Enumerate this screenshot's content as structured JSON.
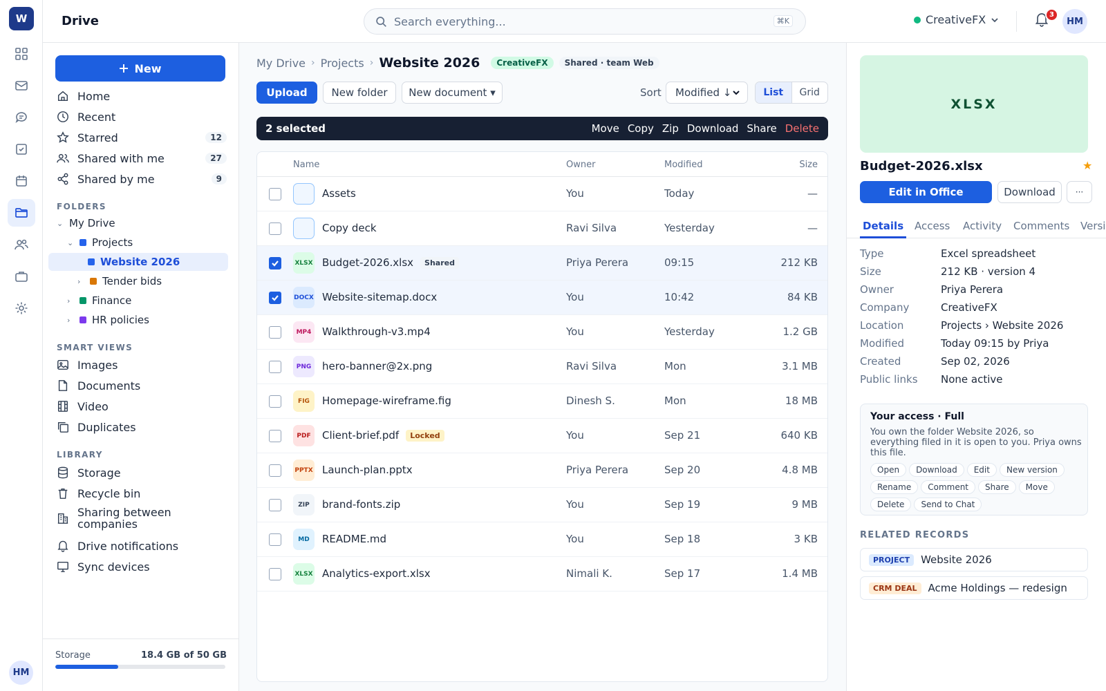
{
  "rail": {
    "logo": "W",
    "icons": [
      "apps-icon",
      "mail-icon",
      "chat-icon",
      "tasks-icon",
      "calendar-icon",
      "folder-icon",
      "people-icon",
      "briefcase-icon",
      "settings-icon"
    ],
    "user_initials": "HM"
  },
  "topbar": {
    "app_title": "Drive",
    "search_placeholder": "Search everything...",
    "search_shortcut": "⌘K",
    "company": "CreativeFX",
    "company_color": "#10b981",
    "notifications": "3",
    "user_initials": "HM"
  },
  "sidebar": {
    "new_label": "New",
    "nav": [
      {
        "label": "Home",
        "icon": "home-icon",
        "count": ""
      },
      {
        "label": "Recent",
        "icon": "clock-icon",
        "count": ""
      },
      {
        "label": "Starred",
        "icon": "star-icon",
        "count": "12"
      },
      {
        "label": "Shared with me",
        "icon": "users-icon",
        "count": "27"
      },
      {
        "label": "Shared by me",
        "icon": "share-icon",
        "count": "9"
      }
    ],
    "folders_label": "FOLDERS",
    "folders": [
      {
        "label": "My Drive"
      },
      {
        "label": "Projects",
        "color": "#2563eb"
      },
      {
        "label": "Website 2026",
        "color": "#2563eb"
      },
      {
        "label": "Tender bids",
        "color": "#d97706"
      },
      {
        "label": "Finance",
        "color": "#059669"
      },
      {
        "label": "HR policies",
        "color": "#7c3aed"
      }
    ],
    "smart_label": "SMART VIEWS",
    "smart": [
      {
        "label": "Images",
        "icon": "image-icon"
      },
      {
        "label": "Documents",
        "icon": "document-icon"
      },
      {
        "label": "Video",
        "icon": "film-icon"
      },
      {
        "label": "Duplicates",
        "icon": "copy-icon"
      }
    ],
    "library_label": "LIBRARY",
    "library": [
      {
        "label": "Storage",
        "icon": "database-icon"
      },
      {
        "label": "Recycle bin",
        "icon": "trash-icon"
      },
      {
        "label": "Sharing between companies",
        "icon": "building-icon"
      },
      {
        "label": "Drive notifications",
        "icon": "bell-icon"
      },
      {
        "label": "Sync devices",
        "icon": "monitor-icon"
      }
    ],
    "storage": {
      "label": "Storage",
      "value": "18.4 GB of 50 GB",
      "fraction": 0.368
    }
  },
  "main": {
    "crumbs": [
      "My Drive",
      "Projects"
    ],
    "current": "Website 2026",
    "company_pill": "CreativeFX",
    "shared_pill": "Shared · team Web",
    "toolbar": {
      "upload": "Upload",
      "new_folder": "New folder",
      "new_document": "New document ▾",
      "sort_label": "Sort",
      "sort_value": "Modified ↓",
      "view_list": "List",
      "view_grid": "Grid"
    },
    "selection": {
      "label": "2 selected",
      "actions": [
        "Move",
        "Copy",
        "Zip",
        "Download",
        "Share",
        "Delete"
      ]
    },
    "columns": {
      "name": "Name",
      "owner": "Owner",
      "modified": "Modified",
      "size": "Size"
    },
    "files": [
      {
        "type": "folder",
        "ext": "",
        "name": "Assets",
        "tag": "",
        "owner": "You",
        "modified": "Today",
        "size": "—",
        "checked": false
      },
      {
        "type": "folder",
        "ext": "",
        "name": "Copy deck",
        "tag": "",
        "owner": "Ravi Silva",
        "modified": "Yesterday",
        "size": "—",
        "checked": false
      },
      {
        "type": "file",
        "ext": "XLSX",
        "name": "Budget-2026.xlsx",
        "tag": "Shared",
        "owner": "Priya Perera",
        "modified": "09:15",
        "size": "212 KB",
        "checked": true
      },
      {
        "type": "file",
        "ext": "DOCX",
        "name": "Website-sitemap.docx",
        "tag": "",
        "owner": "You",
        "modified": "10:42",
        "size": "84 KB",
        "checked": true
      },
      {
        "type": "file",
        "ext": "MP4",
        "name": "Walkthrough-v3.mp4",
        "tag": "",
        "owner": "You",
        "modified": "Yesterday",
        "size": "1.2 GB",
        "checked": false
      },
      {
        "type": "file",
        "ext": "PNG",
        "name": "hero-banner@2x.png",
        "tag": "",
        "owner": "Ravi Silva",
        "modified": "Mon",
        "size": "3.1 MB",
        "checked": false
      },
      {
        "type": "file",
        "ext": "FIG",
        "name": "Homepage-wireframe.fig",
        "tag": "",
        "owner": "Dinesh S.",
        "modified": "Mon",
        "size": "18 MB",
        "checked": false
      },
      {
        "type": "file",
        "ext": "PDF",
        "name": "Client-brief.pdf",
        "tag": "Locked",
        "owner": "You",
        "modified": "Sep 21",
        "size": "640 KB",
        "checked": false
      },
      {
        "type": "file",
        "ext": "PPTX",
        "name": "Launch-plan.pptx",
        "tag": "",
        "owner": "Priya Perera",
        "modified": "Sep 20",
        "size": "4.8 MB",
        "checked": false
      },
      {
        "type": "file",
        "ext": "ZIP",
        "name": "brand-fonts.zip",
        "tag": "",
        "owner": "You",
        "modified": "Sep 19",
        "size": "9 MB",
        "checked": false
      },
      {
        "type": "file",
        "ext": "MD",
        "name": "README.md",
        "tag": "",
        "owner": "You",
        "modified": "Sep 18",
        "size": "3 KB",
        "checked": false
      },
      {
        "type": "file",
        "ext": "XLSX",
        "name": "Analytics-export.xlsx",
        "tag": "",
        "owner": "Nimali K.",
        "modified": "Sep 17",
        "size": "1.4 MB",
        "checked": false
      }
    ]
  },
  "details": {
    "preview_label": "XLSX",
    "title": "Budget-2026.xlsx",
    "star": "★",
    "edit_label": "Edit in Office",
    "download_label": "Download",
    "more_label": "···",
    "tabs": [
      "Details",
      "Access",
      "Activity",
      "Comments",
      "Versi"
    ],
    "fields": [
      {
        "k": "Type",
        "v": "Excel spreadsheet"
      },
      {
        "k": "Size",
        "v": "212 KB · version 4"
      },
      {
        "k": "Owner",
        "v": "Priya Perera"
      },
      {
        "k": "Company",
        "v": "CreativeFX"
      },
      {
        "k": "Location",
        "v": "Projects › Website 2026"
      },
      {
        "k": "Modified",
        "v": "Today 09:15 by Priya"
      },
      {
        "k": "Created",
        "v": "Sep 02, 2026"
      },
      {
        "k": "Public links",
        "v": "None active"
      }
    ],
    "access_title": "Your access · Full",
    "access_text": "You own the folder Website 2026, so everything filed in it is open to you. Priya owns this file.",
    "permissions": [
      "Open",
      "Download",
      "Edit",
      "New version",
      "Rename",
      "Comment",
      "Share",
      "Move",
      "Delete",
      "Send to Chat"
    ],
    "related_label": "RELATED RECORDS",
    "related": [
      {
        "tag": "PROJECT",
        "label": "Website 2026"
      },
      {
        "tag": "CRM DEAL",
        "label": "Acme Holdings — redesign"
      }
    ]
  }
}
